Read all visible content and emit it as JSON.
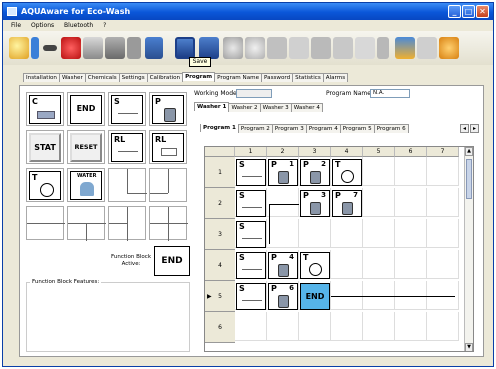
{
  "window": {
    "title": "AQUAware for Eco-Wash"
  },
  "menu": [
    "File",
    "Options",
    "Bluetooth",
    "?"
  ],
  "tooltip": "Save",
  "tabs": [
    "Installation",
    "Washer",
    "Chemicals",
    "Settings",
    "Calibration",
    "Program",
    "Program Name",
    "Password",
    "Statistics",
    "Alarms"
  ],
  "active_tab": "Program",
  "palette": {
    "blocks": [
      {
        "label": "C",
        "icon": "cartridge-icon"
      },
      {
        "label": "END"
      },
      {
        "label": "S",
        "icon": "dose-line-icon"
      },
      {
        "label": "P",
        "icon": "pump-icon"
      },
      {
        "label": "STAT"
      },
      {
        "label": "RESET"
      },
      {
        "label": "RL",
        "icon": "dose-line-icon"
      },
      {
        "label": "RL",
        "icon": "relay-box-icon"
      },
      {
        "label": "T",
        "icon": "clock-icon"
      },
      {
        "label": "WATER",
        "icon": "water-valve-icon"
      }
    ],
    "function_block_active_label": "Function Block Active:",
    "function_block_active_value": "END",
    "features_label": "Function Block Features:"
  },
  "program_panel": {
    "working_mode_label": "Working Mode",
    "working_mode_value": "",
    "program_name_label": "Program Name",
    "program_name_value": "N.A.",
    "washer_tabs": [
      "Washer 1",
      "Washer 2",
      "Washer 3",
      "Washer 4"
    ],
    "program_tabs": [
      "Program 1",
      "Program 2",
      "Program 3",
      "Program 4",
      "Program 5",
      "Program 6"
    ]
  },
  "grid": {
    "columns": [
      "1",
      "2",
      "3",
      "4",
      "5",
      "6",
      "7"
    ],
    "rows": [
      "1",
      "2",
      "3",
      "4",
      "5",
      "6"
    ],
    "current_row": "5",
    "cells": [
      {
        "row": 0,
        "col": 0,
        "label": "S",
        "icon": "dose-line-icon"
      },
      {
        "row": 0,
        "col": 1,
        "label": "P",
        "num": "1",
        "icon": "pump-icon"
      },
      {
        "row": 0,
        "col": 2,
        "label": "P",
        "num": "2",
        "icon": "pump-icon"
      },
      {
        "row": 0,
        "col": 3,
        "label": "T",
        "icon": "clock-icon"
      },
      {
        "row": 1,
        "col": 0,
        "label": "S",
        "icon": "dose-line-icon"
      },
      {
        "row": 1,
        "col": 2,
        "label": "P",
        "num": "3",
        "icon": "pump-icon"
      },
      {
        "row": 1,
        "col": 3,
        "label": "P",
        "num": "7",
        "icon": "pump-icon"
      },
      {
        "row": 2,
        "col": 0,
        "label": "S",
        "icon": "dose-line-icon"
      },
      {
        "row": 3,
        "col": 0,
        "label": "S",
        "icon": "dose-line-icon"
      },
      {
        "row": 3,
        "col": 1,
        "label": "P",
        "num": "4",
        "icon": "pump-icon"
      },
      {
        "row": 3,
        "col": 2,
        "label": "T",
        "icon": "clock-icon"
      },
      {
        "row": 4,
        "col": 0,
        "label": "S",
        "icon": "dose-line-icon"
      },
      {
        "row": 4,
        "col": 1,
        "label": "P",
        "num": "6",
        "icon": "pump-icon"
      },
      {
        "row": 4,
        "col": 2,
        "label": "END",
        "highlight": true
      }
    ]
  }
}
